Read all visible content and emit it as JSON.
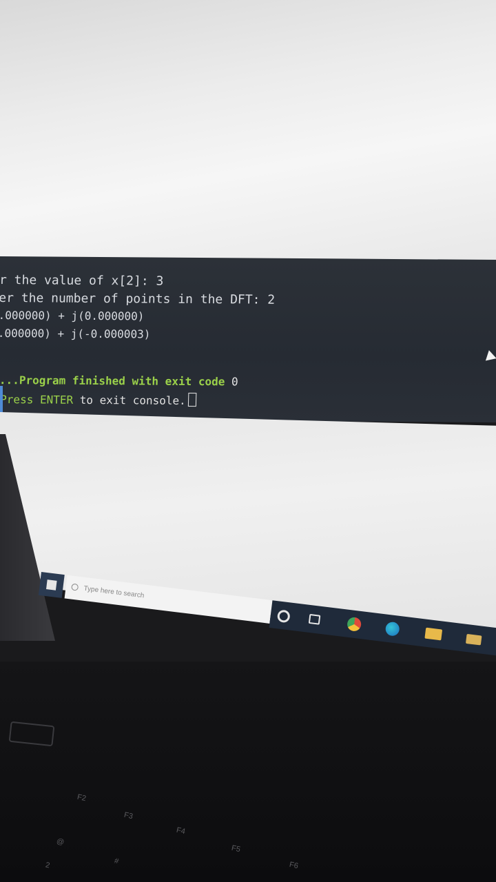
{
  "console": {
    "line1": "r the value of x[2]: 3",
    "line2": "er the number of points in the DFT: 2",
    "line3": ".000000) + j(0.000000)",
    "line4": ".000000) + j(-0.000003)",
    "finished_prefix": "...Program finished with exit code",
    "finished_code": "0",
    "press_prefix": "Press ENTER",
    "press_rest": " to exit console."
  },
  "taskbar": {
    "search_placeholder": "Type here to search",
    "icons": [
      "windows-start-icon",
      "search-icon",
      "cortana-icon",
      "task-view-icon",
      "chrome-icon",
      "edge-icon",
      "file-explorer-icon",
      "app-icon"
    ]
  },
  "keyboard": {
    "keys": [
      "F2",
      "F3",
      "F4",
      "F5",
      "F6",
      "@",
      "2",
      "#"
    ]
  },
  "colors": {
    "console_bg": "#2a2f37",
    "console_text": "#d8dbe0",
    "status_green": "#9bd14a",
    "taskbar_bg": "#1f2a3a"
  }
}
